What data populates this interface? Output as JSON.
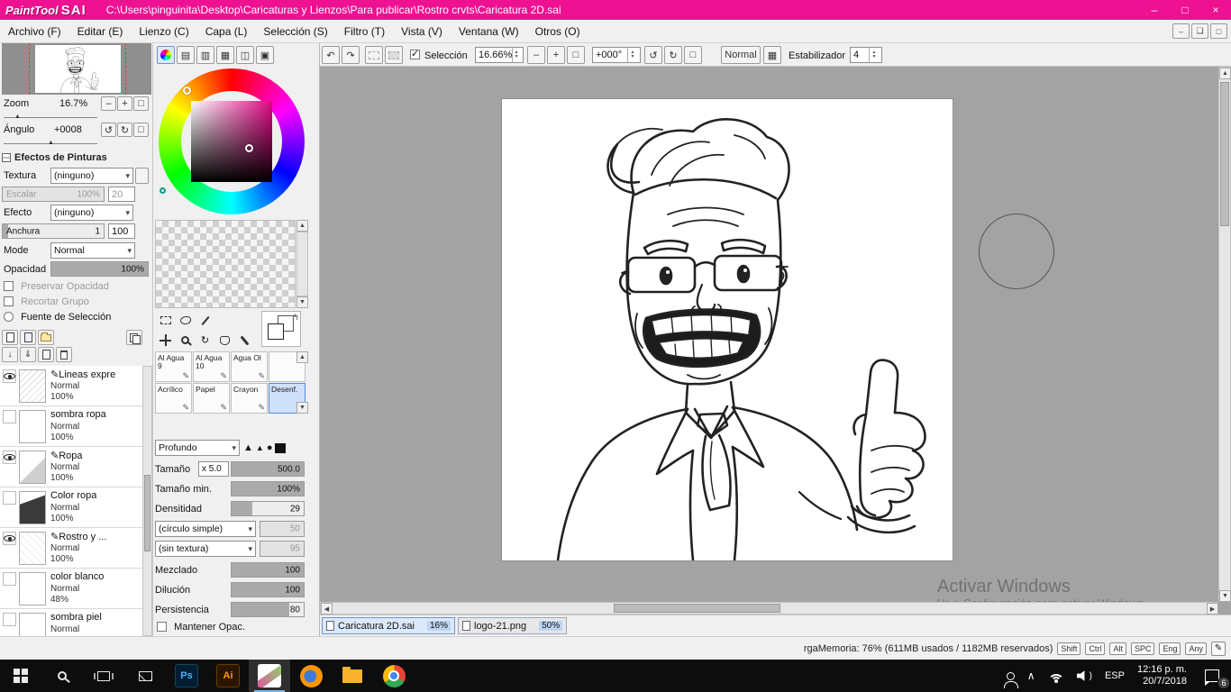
{
  "titlebar": {
    "app": "PaintTool",
    "app2": "SAI",
    "path": "C:\\Users\\pinguinita\\Desktop\\Caricaturas y Lienzos\\Para publicar\\Rostro crvts\\Caricatura 2D.sai"
  },
  "menu": [
    "Archivo (F)",
    "Editar (E)",
    "Lienzo (C)",
    "Capa (L)",
    "Selección (S)",
    "Filtro (T)",
    "Vista (V)",
    "Ventana (W)",
    "Otros (O)"
  ],
  "toolbar": {
    "seleccion": "Selección",
    "zoom": "16.66%",
    "angle": "+000°",
    "normal": "Normal",
    "estabilizador": "Estabilizador",
    "estab_value": "4"
  },
  "navigator": {
    "zoom_label": "Zoom",
    "zoom_value": "16.7%",
    "angle_label": "Ángulo",
    "angle_value": "+0008"
  },
  "effects": {
    "title": "Efectos de Pinturas",
    "textura": "Textura",
    "textura_value": "(ninguno)",
    "escalar": "Escalar",
    "escalar_value": "100%",
    "escalar_num": "20",
    "efecto": "Efecto",
    "efecto_value": "(ninguno)",
    "anchura": "Anchura",
    "anchura_value": "1",
    "anchura_num": "100",
    "mode": "Mode",
    "mode_value": "Normal",
    "opacidad": "Opacidad",
    "opacidad_value": "100%",
    "preservar": "Preservar Opacidad",
    "recortar": "Recortar Grupo",
    "fuente": "Fuente de Selección"
  },
  "layers": [
    {
      "name": "Lineas expre",
      "mode": "Normal",
      "opacity": "100%"
    },
    {
      "name": "sombra ropa",
      "mode": "Normal",
      "opacity": "100%"
    },
    {
      "name": "Ropa",
      "mode": "Normal",
      "opacity": "100%"
    },
    {
      "name": "Color ropa",
      "mode": "Normal",
      "opacity": "100%"
    },
    {
      "name": "Rostro y ...",
      "mode": "Normal",
      "opacity": "100%"
    },
    {
      "name": "color blanco",
      "mode": "Normal",
      "opacity": "48%"
    },
    {
      "name": "sombra piel",
      "mode": "Normal",
      "opacity": "100%"
    }
  ],
  "brushes": [
    "Al Agua 9",
    "Al Agua 10",
    "Agua Ol",
    "",
    "Acrílico",
    "Papel",
    "Crayon",
    "Desenf."
  ],
  "brush_settings": {
    "tip_style": "Profundo",
    "tamano": "Tamaño",
    "tamano_mult": "x 5.0",
    "tamano_value": "500.0",
    "tamano_min": "Tamaño min.",
    "tamano_min_value": "100%",
    "densidad": "Densitidad",
    "densidad_value": "29",
    "forma": "(círculo simple)",
    "forma_value": "50",
    "textura": "(sin textura)",
    "textura_value": "95",
    "mezclado": "Mezclado",
    "mezclado_value": "100",
    "dilucion": "Dilución",
    "dilucion_value": "100",
    "persistencia": "Persistencia",
    "persistencia_value": "80",
    "mantener": "Mantener Opac."
  },
  "tabs": [
    {
      "name": "Caricatura 2D.sai",
      "zoom": "16%"
    },
    {
      "name": "logo-21.png",
      "zoom": "50%"
    }
  ],
  "status": {
    "memory": "rgaMemoria: 76% (611MB usados / 1182MB reservados)",
    "keys": [
      "Shift",
      "Ctrl",
      "Alt",
      "SPC",
      "Eng",
      "Any"
    ]
  },
  "watermark": {
    "line1": "Activar Windows",
    "line2": "Ve a Configuración para activar Windows."
  },
  "taskbar": {
    "lang": "ESP",
    "time": "12:16 p. m.",
    "date": "20/7/2018",
    "notif_count": "6",
    "ps": "Ps",
    "ai": "Ai"
  },
  "colors": {
    "titlebar": "#ee1191",
    "selection_highlight": "#cfe0fa",
    "current_color": "#e10885",
    "pasteboard": "#a3a3a3"
  }
}
